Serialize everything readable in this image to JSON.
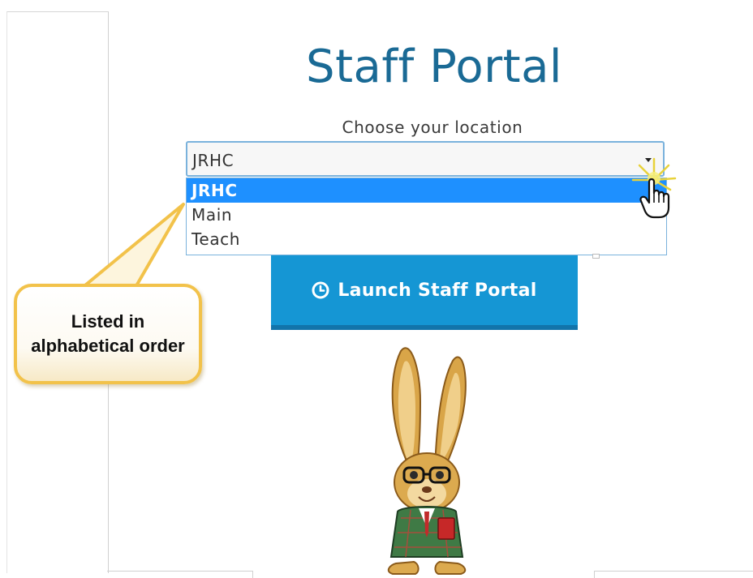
{
  "page": {
    "title": "Staff Portal",
    "location_label": "Choose your location"
  },
  "location_select": {
    "value": "JRHC",
    "options": [
      "JRHC",
      "Main",
      "Teach"
    ],
    "selected_index": 0
  },
  "launch_button": {
    "label": "Launch Staff Portal",
    "icon": "clock-icon"
  },
  "callout": {
    "text": "Listed in alphabetical order"
  },
  "colors": {
    "title": "#1a6a95",
    "button": "#1596d4",
    "selected_option": "#1e90ff",
    "callout_border": "#f2c24a"
  }
}
